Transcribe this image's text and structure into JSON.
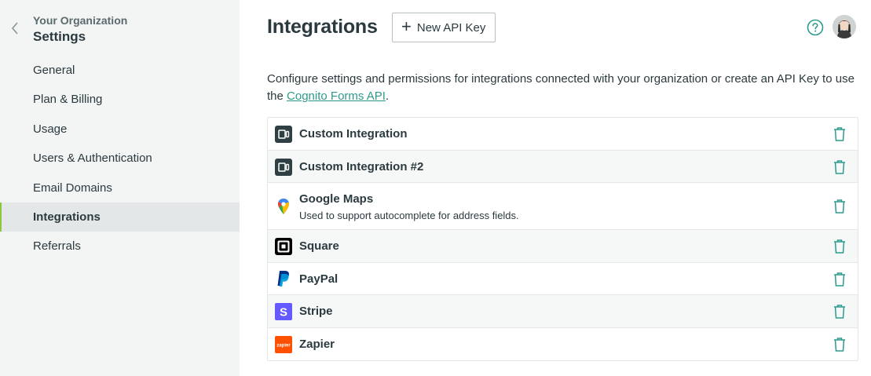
{
  "sidebar": {
    "org_name": "Your Organization",
    "title": "Settings",
    "back_icon": "chevron-left-icon",
    "items": [
      {
        "label": "General",
        "active": false
      },
      {
        "label": "Plan & Billing",
        "active": false
      },
      {
        "label": "Usage",
        "active": false
      },
      {
        "label": "Users & Authentication",
        "active": false
      },
      {
        "label": "Email Domains",
        "active": false
      },
      {
        "label": "Integrations",
        "active": true
      },
      {
        "label": "Referrals",
        "active": false
      }
    ]
  },
  "header": {
    "title": "Integrations",
    "new_key_label": "New API Key",
    "help_icon": "help-circle-icon",
    "avatar_icon": "user-avatar"
  },
  "description": {
    "text_before": "Configure settings and permissions for integrations connected with your organization or create an API Key to use the ",
    "link_text": "Cognito Forms API",
    "text_after": "."
  },
  "integrations": [
    {
      "name": "Custom Integration",
      "subtitle": "",
      "icon": "custom-integration-icon"
    },
    {
      "name": "Custom Integration #2",
      "subtitle": "",
      "icon": "custom-integration-icon"
    },
    {
      "name": "Google Maps",
      "subtitle": "Used to support autocomplete for address fields.",
      "icon": "google-maps-icon"
    },
    {
      "name": "Square",
      "subtitle": "",
      "icon": "square-icon"
    },
    {
      "name": "PayPal",
      "subtitle": "",
      "icon": "paypal-icon"
    },
    {
      "name": "Stripe",
      "subtitle": "",
      "icon": "stripe-icon",
      "logo_letter": "S"
    },
    {
      "name": "Zapier",
      "subtitle": "",
      "icon": "zapier-icon",
      "logo_text": "zapier"
    }
  ],
  "colors": {
    "accent_teal": "#2d9a8c",
    "active_indicator": "#8dc63f",
    "sidebar_bg": "#f3f4f4"
  }
}
